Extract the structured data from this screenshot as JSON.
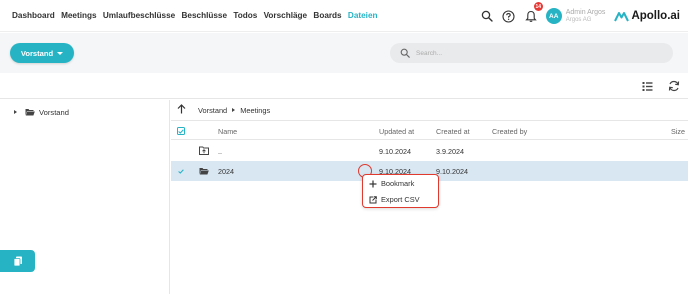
{
  "nav": {
    "items": [
      {
        "label": "Dashboard",
        "active": false
      },
      {
        "label": "Meetings",
        "active": false
      },
      {
        "label": "Umlaufbeschlüsse",
        "active": false
      },
      {
        "label": "Beschlüsse",
        "active": false
      },
      {
        "label": "Todos",
        "active": false
      },
      {
        "label": "Vorschläge",
        "active": false
      },
      {
        "label": "Boards",
        "active": false
      },
      {
        "label": "Dateien",
        "active": true
      }
    ],
    "notification_count": "14",
    "user": {
      "initials": "AA",
      "name": "Admin Argos",
      "org": "Argos AG"
    },
    "brand": "Apollo.ai"
  },
  "subbar": {
    "space_button": "Vorstand",
    "search_placeholder": "Search..."
  },
  "tree": {
    "root_label": "Vorstand"
  },
  "breadcrumb": [
    "Vorstand",
    "Meetings"
  ],
  "table": {
    "columns": [
      "Name",
      "Updated at",
      "Created at",
      "Created by",
      "Size"
    ],
    "rows": [
      {
        "name": "..",
        "updated": "9.10.2024",
        "created": "3.9.2024",
        "created_by": "",
        "size": ""
      },
      {
        "name": "2024",
        "updated": "9.10.2024",
        "created": "9.10.2024",
        "created_by": "",
        "size": ""
      }
    ]
  },
  "context_menu": {
    "items": [
      "Bookmark",
      "Export CSV"
    ]
  },
  "colors": {
    "accent": "#26b4c5",
    "highlight_outline": "#e03a2e",
    "selected_row": "#d9e7f3",
    "badge": "#e53935"
  }
}
